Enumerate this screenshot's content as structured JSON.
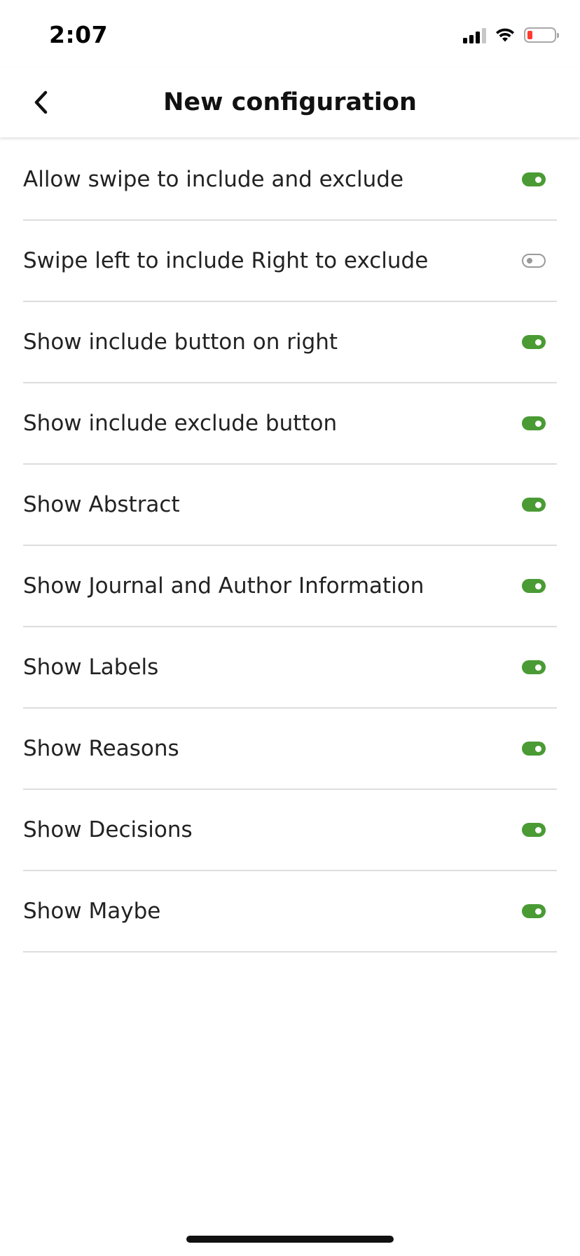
{
  "status_bar": {
    "time": "2:07",
    "icons": [
      "cellular-signal-icon",
      "wifi-icon",
      "battery-low-icon"
    ],
    "battery_color": "#ff3b30"
  },
  "header": {
    "back_icon": "chevron-left-icon",
    "title": "New configuration"
  },
  "accent_color": "#4a9b34",
  "settings": [
    {
      "label": "Allow swipe to include and exclude",
      "enabled": true
    },
    {
      "label": "Swipe left to include Right to exclude",
      "enabled": false
    },
    {
      "label": "Show include button on right",
      "enabled": true
    },
    {
      "label": "Show include exclude button",
      "enabled": true
    },
    {
      "label": "Show Abstract",
      "enabled": true
    },
    {
      "label": "Show Journal and Author Information",
      "enabled": true
    },
    {
      "label": "Show Labels",
      "enabled": true
    },
    {
      "label": "Show Reasons",
      "enabled": true
    },
    {
      "label": "Show Decisions",
      "enabled": true
    },
    {
      "label": "Show Maybe",
      "enabled": true
    }
  ]
}
